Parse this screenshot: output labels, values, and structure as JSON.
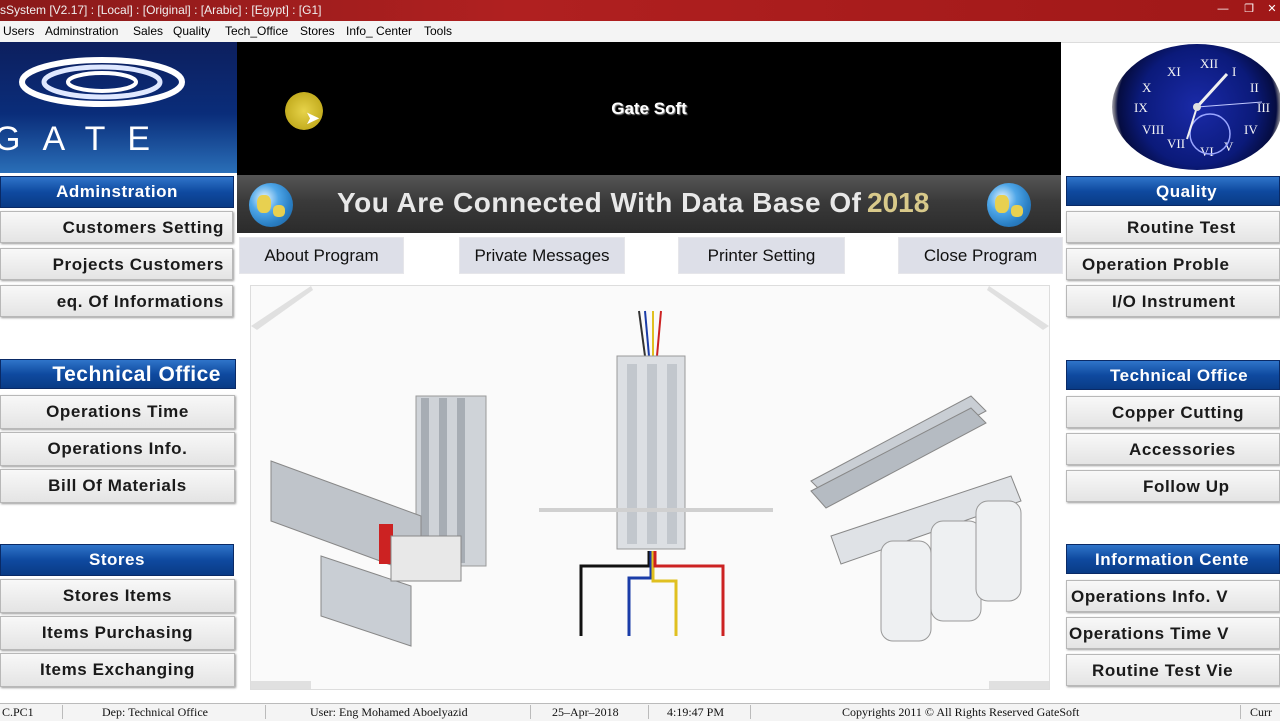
{
  "window": {
    "title": "sSystem [V2.17] : [Local] : [Original] : [Arabic] : [Egypt] : [G1]"
  },
  "menu": [
    "Users",
    "Adminstration",
    "Sales",
    "Quality",
    "Tech_Office",
    "Stores",
    "Info_ Center",
    "Tools"
  ],
  "logo": {
    "text": "GATE"
  },
  "banner": {
    "title": "Gate Soft"
  },
  "connection": {
    "text": "You Are Connected With Data Base Of",
    "year": "2018"
  },
  "top_buttons": [
    "About Program",
    "Private Messages",
    "Printer Setting",
    "Close Program"
  ],
  "left_panel": {
    "admin": {
      "header": "Adminstration",
      "items": [
        "Customers Setting",
        "Projects Customers",
        "eq. Of Informations"
      ]
    },
    "tech": {
      "header": "Technical Office",
      "items": [
        "Operations Time",
        "Operations Info.",
        "Bill Of Materials"
      ]
    },
    "stores": {
      "header": "Stores",
      "items": [
        "Stores Items",
        "Items Purchasing",
        "Items Exchanging"
      ]
    }
  },
  "right_panel": {
    "quality": {
      "header": "Quality",
      "items": [
        "Routine Test",
        "Operation Proble",
        "I/O Instrument"
      ]
    },
    "tech": {
      "header": "Technical Office",
      "items": [
        "Copper Cutting",
        "Accessories",
        "Follow Up"
      ]
    },
    "info": {
      "header": "Information Cente",
      "items": [
        "Operations Info. V",
        "Operations Time V",
        "Routine Test Vie"
      ]
    }
  },
  "clock_numerals": [
    "XII",
    "I",
    "II",
    "III",
    "IV",
    "V",
    "VI",
    "VII",
    "VIII",
    "IX",
    "X",
    "XI"
  ],
  "status": {
    "pc": "C.PC1",
    "dep": "Dep: Technical Office",
    "user": "User: Eng Mohamed Aboelyazid",
    "date": "25–Apr–2018",
    "time": "4:19:47 PM",
    "copyright": "Copyrights 2011 © All Rights Reserved GateSoft",
    "cur": "Curr"
  }
}
